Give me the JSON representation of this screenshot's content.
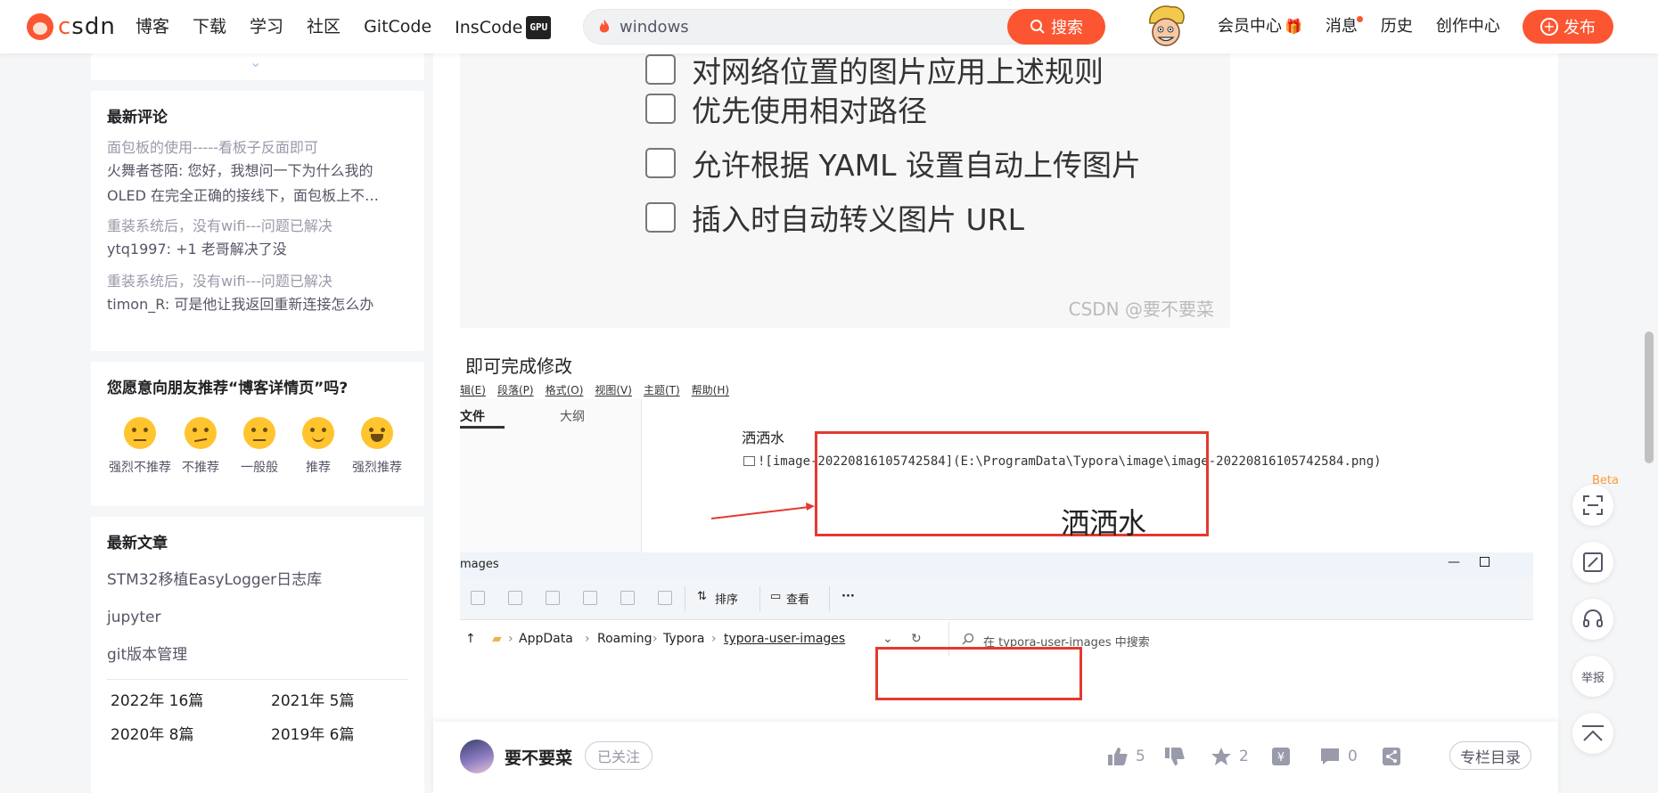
{
  "nav": {
    "logo_text": "CSDN",
    "links": [
      "博客",
      "下载",
      "学习",
      "社区",
      "GitCode",
      "InsCode"
    ],
    "gpu_badge": "GPU",
    "search_value": "windows",
    "search_button": "搜索",
    "right_links": [
      "会员中心",
      "消息",
      "历史",
      "创作中心"
    ],
    "publish_button": "发布"
  },
  "sidebar": {
    "comments": {
      "title": "最新评论",
      "items": [
        {
          "source": "面包板的使用-----看板子反面即可",
          "text": "火舞者苍陌: 您好，我想问一下为什么我的OLED 在完全正确的接线下，面包板上不…"
        },
        {
          "source": "重装系统后，没有wifi---问题已解决",
          "text": "ytq1997: +1 老哥解决了没"
        },
        {
          "source": "重装系统后，没有wifi---问题已解决",
          "text": "timon_R: 可是他让我返回重新连接怎么办"
        }
      ]
    },
    "recommend": {
      "title": "您愿意向朋友推荐“博客详情页”吗?",
      "options": [
        "强烈不推荐",
        "不推荐",
        "一般般",
        "推荐",
        "强烈推荐"
      ]
    },
    "articles": {
      "title": "最新文章",
      "items": [
        "STM32移植EasyLogger日志库",
        "jupyter",
        "git版本管理"
      ],
      "archive": [
        "2022年  16篇",
        "2021年  5篇",
        "2020年  8篇",
        "2019年  6篇"
      ]
    }
  },
  "article": {
    "options": [
      "对网络位置的图片应用上述规则",
      "优先使用相对路径",
      "允许根据 YAML 设置自动上传图片",
      "插入时自动转义图片 URL"
    ],
    "watermark": "CSDN @要不要菜",
    "paragraph": "即可完成修改",
    "typora": {
      "menu": [
        "辑(E)",
        "段落(P)",
        "格式(O)",
        "视图(V)",
        "主题(T)",
        "帮助(H)"
      ],
      "tab_files": "文件",
      "tab_outline": "大纲",
      "doc_title": "洒洒水",
      "code_line": "![image-20220816105742584](E:\\ProgramData\\Typora\\image\\image-20220816105742584.png)",
      "rendered_text": "洒洒水"
    },
    "explorer": {
      "title": "mages",
      "sort_label": "排序",
      "view_label": "查看",
      "more_label": "···",
      "crumbs": [
        "AppData",
        "Roaming",
        "Typora",
        "typora-user-images"
      ],
      "search_placeholder": "在 typora-user-images 中搜索"
    }
  },
  "bottom": {
    "author": "要不要菜",
    "follow": "已关注",
    "likes": "5",
    "favorites": "2",
    "comments": "0",
    "column_btn": "专栏目录"
  },
  "floating": {
    "beta": "Beta",
    "report": "举报"
  },
  "colors": {
    "brand": "#fc5531",
    "annotation_red": "#e33a31"
  }
}
